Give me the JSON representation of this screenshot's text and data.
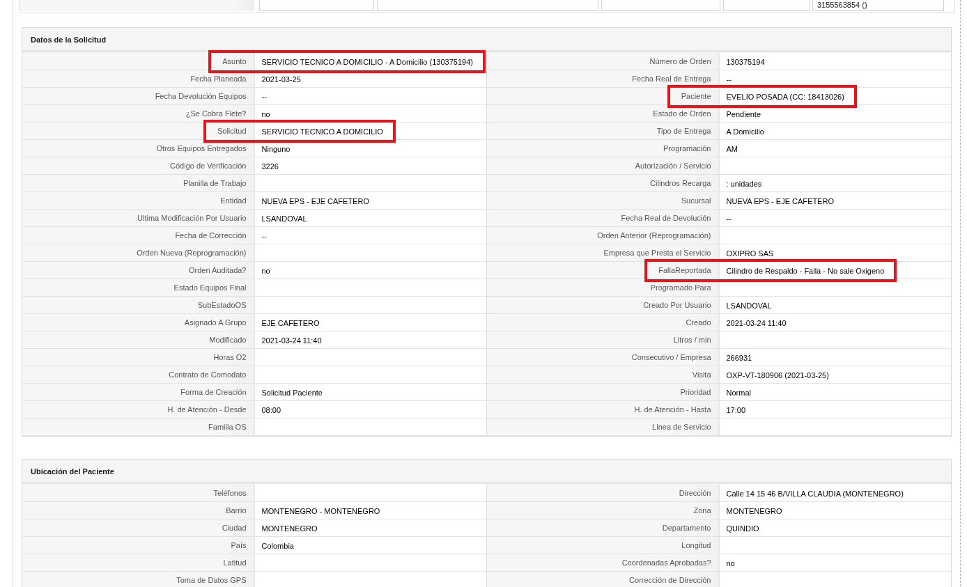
{
  "previous_row": {
    "cells": [
      {
        "kind": "empty"
      },
      {
        "kind": "empty"
      },
      {
        "kind": "empty"
      },
      {
        "kind": "empty"
      },
      {
        "kind": "text",
        "text": "3155563854 ()"
      }
    ]
  },
  "sections": [
    {
      "title": "Datos de la Solicitud",
      "rows": [
        {
          "left": {
            "label": "Asunto",
            "value": "SERVICIO TECNICO A DOMICILIO - A Domicilio (130375194)",
            "highlighted": true
          },
          "right": {
            "label": "Número de Orden",
            "value": "130375194",
            "highlighted": false
          }
        },
        {
          "left": {
            "label": "Fecha Planeada",
            "value": "2021-03-25",
            "highlighted": false
          },
          "right": {
            "label": "Fecha Real de Entrega",
            "value": "--",
            "highlighted": false
          }
        },
        {
          "left": {
            "label": "Fecha Devolución Equipos",
            "value": "--",
            "highlighted": false
          },
          "right": {
            "label": "Paciente",
            "value": "EVELIO POSADA (CC: 18413026)",
            "highlighted": true
          }
        },
        {
          "left": {
            "label": "¿Se Cobra Flete?",
            "value": "no",
            "highlighted": false
          },
          "right": {
            "label": "Estado de Orden",
            "value": "Pendiente",
            "highlighted": false
          }
        },
        {
          "left": {
            "label": "Solicitud",
            "value": "SERVICIO TECNICO A DOMICILIO",
            "highlighted": true
          },
          "right": {
            "label": "Tipo de Entrega",
            "value": "A Domicilio",
            "highlighted": false
          }
        },
        {
          "left": {
            "label": "Otros Equipos Entregados",
            "value": "Ninguno",
            "highlighted": false
          },
          "right": {
            "label": "Programación",
            "value": "AM",
            "highlighted": false
          }
        },
        {
          "left": {
            "label": "Código de Verificación",
            "value": "3226",
            "highlighted": false
          },
          "right": {
            "label": "Autorización / Servicio",
            "highlighted": false
          }
        },
        {
          "left": {
            "label": "Planilla de Trabajo",
            "highlighted": false
          },
          "right": {
            "label": "Cilindros Recarga",
            "value": ": unidades",
            "highlighted": false
          }
        },
        {
          "left": {
            "label": "Entidad",
            "value": "NUEVA EPS - EJE CAFETERO",
            "highlighted": false
          },
          "right": {
            "label": "Sucursal",
            "value": "NUEVA EPS - EJE CAFETERO",
            "highlighted": false
          }
        },
        {
          "left": {
            "label": "Ultima Modificación Por Usuario",
            "value": "LSANDOVAL",
            "highlighted": false
          },
          "right": {
            "label": "Fecha Real de Devolución",
            "value": "--",
            "highlighted": false
          }
        },
        {
          "left": {
            "label": "Fecha de Corrección",
            "value": "--",
            "highlighted": false
          },
          "right": {
            "label": "Orden Anterior (Reprogramación)",
            "highlighted": false
          }
        },
        {
          "left": {
            "label": "Orden Nueva (Reprogramación)",
            "highlighted": false
          },
          "right": {
            "label": "Empresa que Presta el Servicio",
            "value": "OXIPRO SAS",
            "highlighted": false
          }
        },
        {
          "left": {
            "label": "Orden Auditada?",
            "value": "no",
            "highlighted": false
          },
          "right": {
            "label": "FallaReportada",
            "value": "Cilindro de Respaldo - Falla - No sale Oxigeno",
            "highlighted": true
          }
        },
        {
          "left": {
            "label": "Estado Equipos Final",
            "highlighted": false
          },
          "right": {
            "label": "Programado Para",
            "highlighted": false
          }
        },
        {
          "left": {
            "label": "SubEstadoOS",
            "highlighted": false
          },
          "right": {
            "label": "Creado Por Usuario",
            "value": "LSANDOVAL",
            "highlighted": false
          }
        },
        {
          "left": {
            "label": "Asignado A Grupo",
            "value": "EJE CAFETERO",
            "highlighted": false
          },
          "right": {
            "label": "Creado",
            "value": "2021-03-24 11:40",
            "highlighted": false
          }
        },
        {
          "left": {
            "label": "Modificado",
            "value": "2021-03-24 11:40",
            "highlighted": false
          },
          "right": {
            "label": "Litros / min",
            "highlighted": false
          }
        },
        {
          "left": {
            "label": "Horas O2",
            "highlighted": false
          },
          "right": {
            "label": "Consecutivo / Empresa",
            "value": "266931",
            "highlighted": false
          }
        },
        {
          "left": {
            "label": "Contrato de Comodato",
            "highlighted": false
          },
          "right": {
            "label": "Visita",
            "value": "OXP-VT-180906 (2021-03-25)",
            "highlighted": false
          }
        },
        {
          "left": {
            "label": "Forma de Creación",
            "value": "Solicitud Paciente",
            "highlighted": false
          },
          "right": {
            "label": "Prioridad",
            "value": "Normal",
            "highlighted": false
          }
        },
        {
          "left": {
            "label": "H. de Atención - Desde",
            "value": "08:00",
            "highlighted": false
          },
          "right": {
            "label": "H. de Atención - Hasta",
            "value": "17:00",
            "highlighted": false
          }
        },
        {
          "left": {
            "label": "Familia OS",
            "highlighted": false
          },
          "right": {
            "label": "Linea de Servicio",
            "highlighted": false
          }
        }
      ]
    },
    {
      "title": "Ubicación del Paciente",
      "rows": [
        {
          "left": {
            "label": "Teléfonos",
            "highlighted": false
          },
          "right": {
            "label": "Dirección",
            "value": "Calle 14 15 46 B/VILLA CLAUDIA (MONTENEGRO)",
            "highlighted": false
          }
        },
        {
          "left": {
            "label": "Barrio",
            "value": "MONTENEGRO - MONTENEGRO",
            "highlighted": false
          },
          "right": {
            "label": "Zona",
            "value": "MONTENEGRO",
            "highlighted": false
          }
        },
        {
          "left": {
            "label": "Ciudad",
            "value": "MONTENEGRO",
            "highlighted": false
          },
          "right": {
            "label": "Departamento",
            "value": "QUINDIO",
            "highlighted": false
          }
        },
        {
          "left": {
            "label": "País",
            "value": "Colombia",
            "highlighted": false
          },
          "right": {
            "label": "Longitud",
            "highlighted": false
          }
        },
        {
          "left": {
            "label": "Latitud",
            "highlighted": false
          },
          "right": {
            "label": "Coordenadas Aprobadas?",
            "value": "no",
            "highlighted": false
          }
        },
        {
          "left": {
            "label": "Toma de Datos GPS",
            "highlighted": false
          },
          "right": {
            "label": "Corrección de Dirección",
            "highlighted": false
          }
        }
      ]
    }
  ]
}
